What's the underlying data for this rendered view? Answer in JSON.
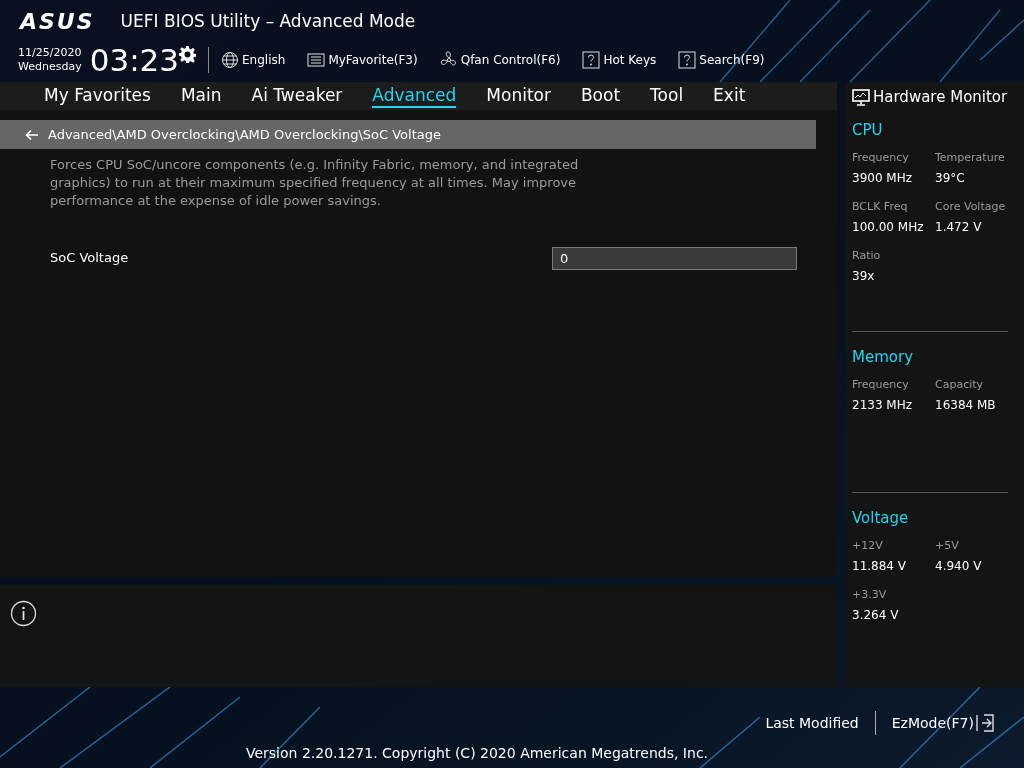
{
  "header": {
    "logo": "ASUS",
    "title": "UEFI BIOS Utility – Advanced Mode",
    "date": "11/25/2020",
    "weekday": "Wednesday",
    "time": "03:23",
    "toolbar": [
      {
        "kind": "globe",
        "label": "English"
      },
      {
        "kind": "list",
        "label": "MyFavorite(F3)"
      },
      {
        "kind": "fan",
        "label": "Qfan Control(F6)"
      },
      {
        "kind": "question",
        "label": "Hot Keys"
      },
      {
        "kind": "question",
        "label": "Search(F9)"
      }
    ]
  },
  "tabs": [
    {
      "label": "My Favorites",
      "selected": false
    },
    {
      "label": "Main",
      "selected": false
    },
    {
      "label": "Ai Tweaker",
      "selected": false
    },
    {
      "label": "Advanced",
      "selected": true
    },
    {
      "label": "Monitor",
      "selected": false
    },
    {
      "label": "Boot",
      "selected": false
    },
    {
      "label": "Tool",
      "selected": false
    },
    {
      "label": "Exit",
      "selected": false
    }
  ],
  "breadcrumb": "Advanced\\AMD Overclocking\\AMD Overclocking\\SoC Voltage",
  "description": "Forces CPU SoC/uncore components (e.g. Infinity Fabric, memory, and integrated graphics) to run at their maximum specified frequency at all times. May improve performance at the expense of idle power savings.",
  "settings": [
    {
      "label": "SoC Voltage",
      "value": "0"
    }
  ],
  "hardware_monitor": {
    "title": "Hardware Monitor",
    "sections": [
      {
        "title": "CPU",
        "items": [
          {
            "label": "Frequency",
            "value": "3900 MHz"
          },
          {
            "label": "Temperature",
            "value": "39°C"
          },
          {
            "label": "BCLK Freq",
            "value": "100.00 MHz"
          },
          {
            "label": "Core Voltage",
            "value": "1.472 V"
          },
          {
            "label": "Ratio",
            "value": "39x"
          }
        ]
      },
      {
        "title": "Memory",
        "items": [
          {
            "label": "Frequency",
            "value": "2133 MHz"
          },
          {
            "label": "Capacity",
            "value": "16384 MB"
          }
        ]
      },
      {
        "title": "Voltage",
        "items": [
          {
            "label": "+12V",
            "value": "11.884 V"
          },
          {
            "label": "+5V",
            "value": "4.940 V"
          },
          {
            "label": "+3.3V",
            "value": "3.264 V"
          }
        ]
      }
    ]
  },
  "footer": {
    "actions": [
      {
        "kind": "plain",
        "label": "Last Modified"
      },
      {
        "kind": "exit",
        "label": "EzMode(F7)"
      }
    ],
    "version": "Version 2.20.1271. Copyright (C) 2020 American Megatrends, Inc."
  }
}
